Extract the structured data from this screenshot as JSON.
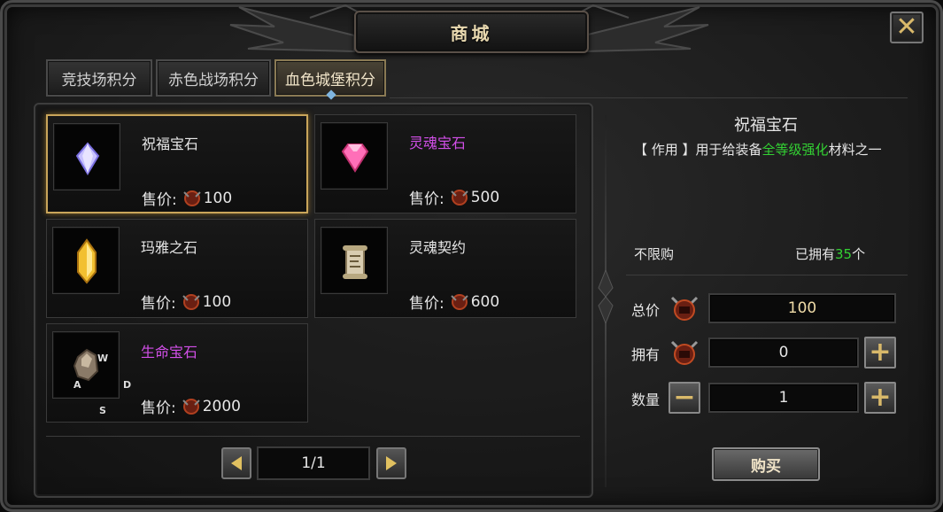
{
  "window": {
    "title": "商城",
    "close_symbol": "✕"
  },
  "tabs": [
    {
      "label": "竞技场积分",
      "active": false
    },
    {
      "label": "赤色战场积分",
      "active": false
    },
    {
      "label": "血色城堡积分",
      "active": true
    }
  ],
  "items": [
    {
      "name": "祝福宝石",
      "name_color": "#e6e6e6",
      "price_label": "售价:",
      "price": "100",
      "icon": "blessing-gem-icon",
      "selected": true
    },
    {
      "name": "灵魂宝石",
      "name_color": "#d24fe8",
      "price_label": "售价:",
      "price": "500",
      "icon": "soul-gem-icon",
      "selected": false
    },
    {
      "name": "玛雅之石",
      "name_color": "#e6e6e6",
      "price_label": "售价:",
      "price": "100",
      "icon": "maya-stone-icon",
      "selected": false
    },
    {
      "name": "灵魂契约",
      "name_color": "#e6e6e6",
      "price_label": "售价:",
      "price": "600",
      "icon": "soul-contract-scroll-icon",
      "selected": false
    },
    {
      "name": "生命宝石",
      "name_color": "#d24fe8",
      "price_label": "售价:",
      "price": "2000",
      "icon": "life-gem-icon",
      "selected": false,
      "key_hints": {
        "up": "W",
        "left": "A",
        "right": "D",
        "down": "S"
      }
    }
  ],
  "pagination": {
    "page": "1/1"
  },
  "detail": {
    "title": "祝福宝石",
    "desc_prefix": "【 作用 】用于给装备",
    "desc_highlight": "全等级强化",
    "desc_suffix": "材料之一",
    "limit_text": "不限购",
    "owned_prefix": "已拥有",
    "owned_count": "35",
    "owned_suffix": "个"
  },
  "purchase": {
    "total_label": "总价",
    "total_value": "100",
    "have_label": "拥有",
    "have_value": "0",
    "qty_label": "数量",
    "qty_value": "1",
    "buy_label": "购买"
  },
  "colors": {
    "accent_gold": "#c9a55a",
    "highlight_green": "#33d233",
    "purple_name": "#d24fe8"
  }
}
